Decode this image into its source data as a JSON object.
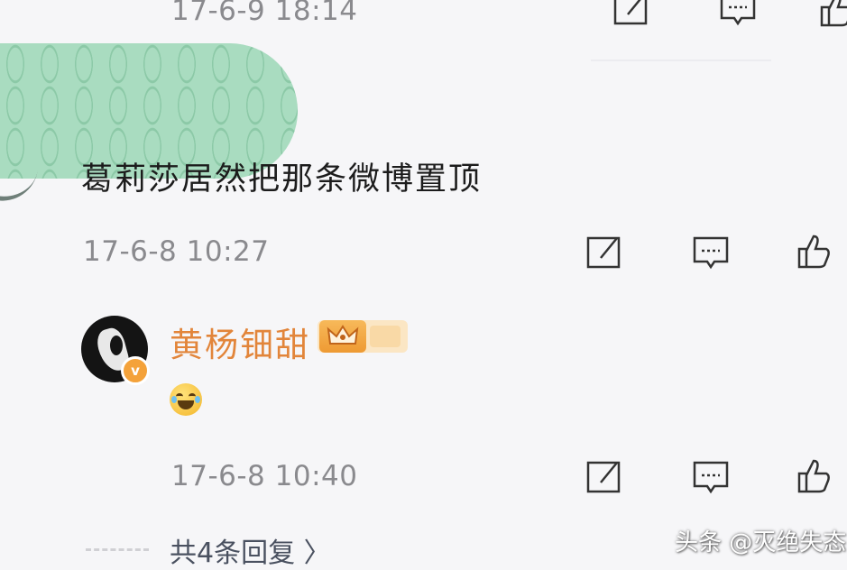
{
  "previous_comment": {
    "timestamp": "17-6-9 18:14"
  },
  "quoted_comment": {
    "text": "葛莉莎居然把那条微博置顶",
    "timestamp": "17-6-8 10:27"
  },
  "reply_comment": {
    "username": "黄杨钿甜",
    "verified_badge": "v",
    "emoji": "laughing-with-tears",
    "timestamp": "17-6-8 10:40",
    "replies_link": "共4条回复 〉"
  },
  "actions": {
    "icons": [
      "share-icon",
      "comment-icon",
      "like-icon"
    ]
  },
  "watermark": "头条 @灭绝失态",
  "colors": {
    "username": "#e2853a",
    "timestamp": "#8a8a8e",
    "accent_badge": "#f4a23a",
    "background": "#f6f6f8"
  }
}
